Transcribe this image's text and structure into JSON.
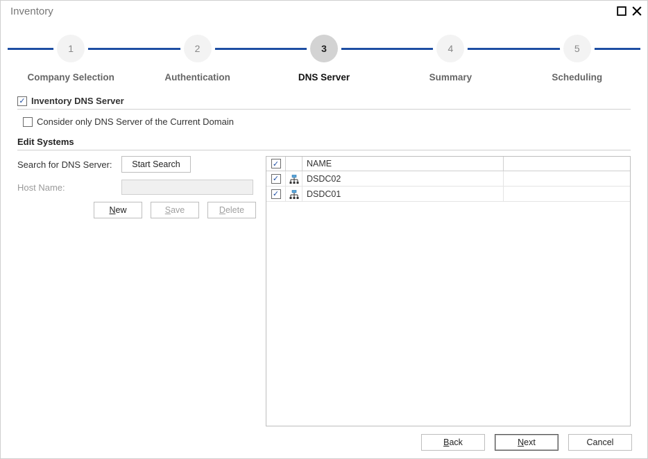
{
  "window": {
    "title": "Inventory"
  },
  "stepper": {
    "steps": [
      {
        "num": "1",
        "label": "Company Selection"
      },
      {
        "num": "2",
        "label": "Authentication"
      },
      {
        "num": "3",
        "label": "DNS Server"
      },
      {
        "num": "4",
        "label": "Summary"
      },
      {
        "num": "5",
        "label": "Scheduling"
      }
    ],
    "active_index": 2
  },
  "checks": {
    "inventory_dns_label": "Inventory DNS Server",
    "inventory_dns_checked": "✓",
    "consider_only_label": "Consider only DNS Server of the Current Domain",
    "consider_only_checked": ""
  },
  "edit_systems_title": "Edit Systems",
  "left": {
    "search_label": "Search for DNS Server:",
    "start_search_btn": "Start Search",
    "host_label": "Host Name:",
    "host_value": "",
    "new_btn": "New",
    "save_btn": "Save",
    "delete_btn": "Delete"
  },
  "table": {
    "header_name": "NAME",
    "rows": [
      {
        "checked": "✓",
        "name": "DSDC02"
      },
      {
        "checked": "✓",
        "name": "DSDC01"
      }
    ]
  },
  "footer": {
    "back": "Back",
    "next": "Next",
    "cancel": "Cancel"
  }
}
